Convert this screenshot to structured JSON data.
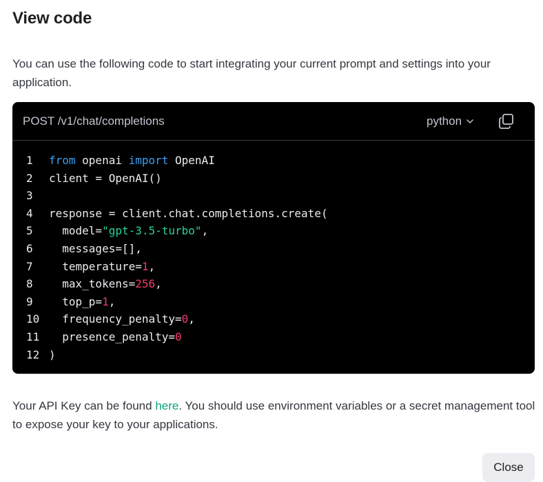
{
  "dialog": {
    "title": "View code",
    "intro": "You can use the following code to start integrating your current prompt and settings into your application."
  },
  "code_panel": {
    "endpoint": "POST /v1/chat/completions",
    "language": "python",
    "lines": [
      {
        "n": "1",
        "segments": [
          {
            "t": "from",
            "c": "kw"
          },
          {
            "t": " openai ",
            "c": ""
          },
          {
            "t": "import",
            "c": "kw"
          },
          {
            "t": " OpenAI",
            "c": ""
          }
        ]
      },
      {
        "n": "2",
        "segments": [
          {
            "t": "client = OpenAI()",
            "c": ""
          }
        ]
      },
      {
        "n": "3",
        "segments": []
      },
      {
        "n": "4",
        "segments": [
          {
            "t": "response = client.chat.completions.create(",
            "c": ""
          }
        ]
      },
      {
        "n": "5",
        "segments": [
          {
            "t": "  model=",
            "c": ""
          },
          {
            "t": "\"gpt-3.5-turbo\"",
            "c": "str"
          },
          {
            "t": ",",
            "c": ""
          }
        ]
      },
      {
        "n": "6",
        "segments": [
          {
            "t": "  messages=[],",
            "c": ""
          }
        ]
      },
      {
        "n": "7",
        "segments": [
          {
            "t": "  temperature=",
            "c": ""
          },
          {
            "t": "1",
            "c": "num"
          },
          {
            "t": ",",
            "c": ""
          }
        ]
      },
      {
        "n": "8",
        "segments": [
          {
            "t": "  max_tokens=",
            "c": ""
          },
          {
            "t": "256",
            "c": "num"
          },
          {
            "t": ",",
            "c": ""
          }
        ]
      },
      {
        "n": "9",
        "segments": [
          {
            "t": "  top_p=",
            "c": ""
          },
          {
            "t": "1",
            "c": "num"
          },
          {
            "t": ",",
            "c": ""
          }
        ]
      },
      {
        "n": "10",
        "segments": [
          {
            "t": "  frequency_penalty=",
            "c": ""
          },
          {
            "t": "0",
            "c": "num"
          },
          {
            "t": ",",
            "c": ""
          }
        ]
      },
      {
        "n": "11",
        "segments": [
          {
            "t": "  presence_penalty=",
            "c": ""
          },
          {
            "t": "0",
            "c": "num"
          }
        ]
      },
      {
        "n": "12",
        "segments": [
          {
            "t": ")",
            "c": ""
          }
        ]
      }
    ],
    "copy_icon": "copy-icon",
    "chevron_icon": "chevron-down-icon"
  },
  "footer": {
    "before_link": "Your API Key can be found ",
    "link_text": "here",
    "after_link": ". You should use environment variables or a secret management tool to expose your key to your applications."
  },
  "actions": {
    "close_label": "Close"
  },
  "colors": {
    "keyword": "#3a9ff2",
    "string": "#2bd396",
    "number": "#f23a6a",
    "link": "#10a37f",
    "code_background": "#000000"
  }
}
